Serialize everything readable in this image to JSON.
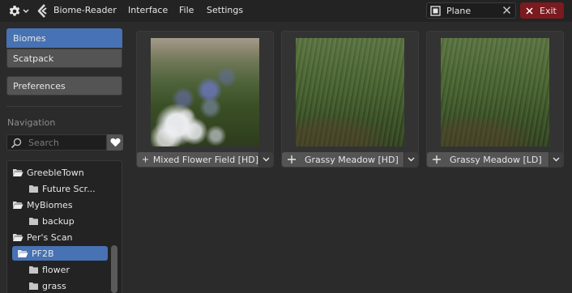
{
  "topbar": {
    "gear_icon": "gear-icon",
    "logo_icon": "biome-reader-logo",
    "app_title": "Biome-Reader",
    "menus": [
      "Interface",
      "File",
      "Settings"
    ],
    "object_field": {
      "icon": "object-icon",
      "value": "Plane"
    },
    "exit_label": "Exit",
    "exit_color": "#7b1a1f"
  },
  "sidebar": {
    "tabs": [
      {
        "label": "Biomes",
        "selected": true
      },
      {
        "label": "Scatpack",
        "selected": false
      }
    ],
    "preferences_label": "Preferences",
    "navigation_label": "Navigation",
    "search_placeholder": "Search",
    "favorites_icon": "heart-icon",
    "tree": [
      {
        "label": "GreebleTown",
        "level": 0,
        "open": true,
        "selected": false
      },
      {
        "label": "Future Scr...",
        "level": 1,
        "open": false,
        "selected": false
      },
      {
        "label": "MyBiomes",
        "level": 0,
        "open": true,
        "selected": false
      },
      {
        "label": "backup",
        "level": 1,
        "open": false,
        "selected": false
      },
      {
        "label": "Per's Scan",
        "level": 0,
        "open": true,
        "selected": false
      },
      {
        "label": "PF2B",
        "level": 0,
        "open": true,
        "selected": true
      },
      {
        "label": "flower",
        "level": 1,
        "open": false,
        "selected": false
      },
      {
        "label": "grass",
        "level": 1,
        "open": false,
        "selected": false
      }
    ]
  },
  "cards": [
    {
      "label": "Mixed Flower Field [HD]",
      "thumbnail": "flower-field"
    },
    {
      "label": "Grassy Meadow [HD]",
      "thumbnail": "grass-meadow"
    },
    {
      "label": "Grassy Meadow [LD]",
      "thumbnail": "grass-meadow"
    }
  ],
  "colors": {
    "accent": "#4772b3",
    "background": "#2b2b2b",
    "topbar": "#232323",
    "button": "#545454"
  }
}
